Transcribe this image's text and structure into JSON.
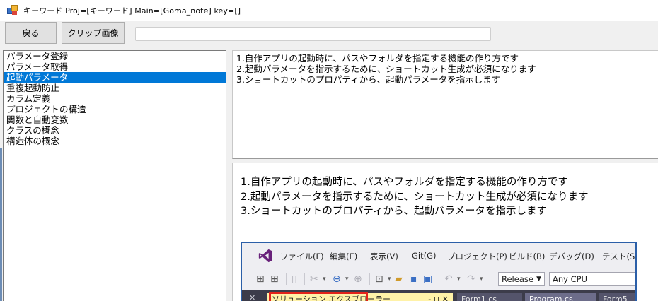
{
  "window": {
    "title": "キーワード  Proj=[キーワード]  Main=[Goma_note]  key=[]"
  },
  "toolbar": {
    "back_label": "戻る",
    "clip_label": "クリップ画像",
    "path_value": ""
  },
  "keywords": [
    "パラメータ登録",
    "パラメータ取得",
    "起動パラメータ",
    "重複起動防止",
    "カラム定義",
    "プロジェクトの構造",
    "関数と自動変数",
    "クラスの概念",
    "構造体の概念"
  ],
  "selected_index": 2,
  "note_text": [
    "1.自作アプリの起動時に、パスやフォルダを指定する機能の作り方です",
    "2.起動パラメータを指示するために、ショートカット生成が必須になります",
    "3.ショートカットのプロパティから、起動パラメータを指示します"
  ],
  "rich_text": [
    "1.自作アプリの起動時に、パスやフォルダを指定する機能の作り方です",
    "2.起動パラメータを指示するために、ショートカット生成が必須になります",
    "3.ショートカットのプロパティから、起動パラメータを指示します"
  ],
  "vs_screenshot": {
    "menu": [
      "ファイル(F)",
      "編集(E)",
      "表示(V)",
      "Git(G)",
      "プロジェクト(P)",
      "ビルド(B)",
      "デバッグ(D)",
      "テスト(S)"
    ],
    "config_combo": "Release",
    "platform_combo": "Any CPU",
    "tabs": {
      "solution": "ソリューション エクスプローラー",
      "tab1": "Form1.cs",
      "tab2": "Program.cs",
      "tab3": "Form5"
    }
  },
  "colors": {
    "selection": "#0078d7",
    "vs_purple": "#68217a",
    "highlight_red": "#e2231a"
  }
}
